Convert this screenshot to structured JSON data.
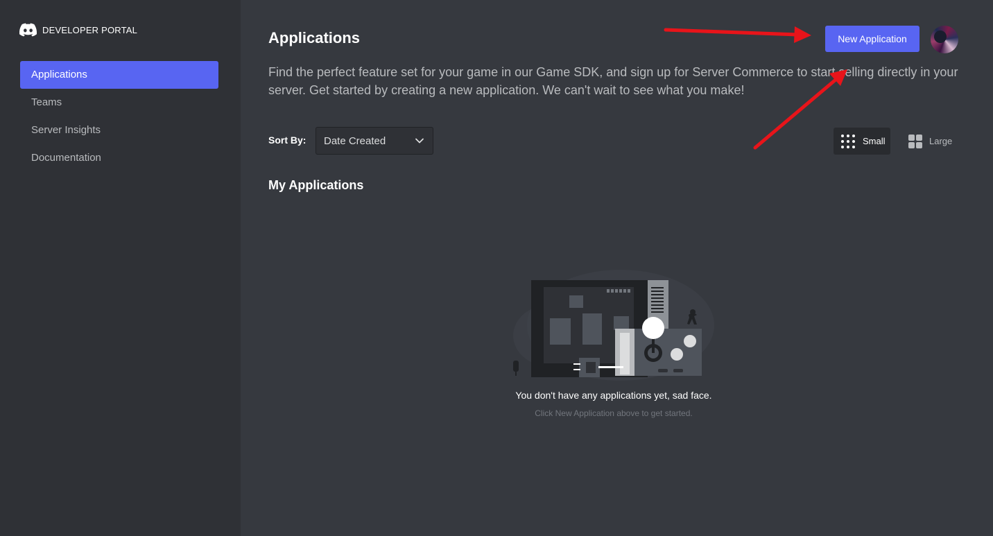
{
  "brand": {
    "label": "DEVELOPER PORTAL"
  },
  "sidebar": {
    "items": [
      {
        "label": "Applications",
        "active": true
      },
      {
        "label": "Teams",
        "active": false
      },
      {
        "label": "Server Insights",
        "active": false
      },
      {
        "label": "Documentation",
        "active": false
      }
    ]
  },
  "header": {
    "title": "Applications",
    "new_app_label": "New Application"
  },
  "intro": {
    "text": "Find the perfect feature set for your game in our Game SDK, and sign up for Server Commerce to start selling directly in your server. Get started by creating a new application. We can't wait to see what you make!"
  },
  "sort": {
    "label": "Sort By:",
    "value": "Date Created"
  },
  "view": {
    "small_label": "Small",
    "large_label": "Large"
  },
  "section": {
    "title": "My Applications"
  },
  "empty": {
    "title": "You don't have any applications yet, sad face.",
    "subtitle": "Click New Application above to get started."
  },
  "colors": {
    "accent": "#5865f2",
    "background": "#36393f",
    "sidebar": "#2f3136",
    "annotation_arrow": "#e8141a"
  }
}
